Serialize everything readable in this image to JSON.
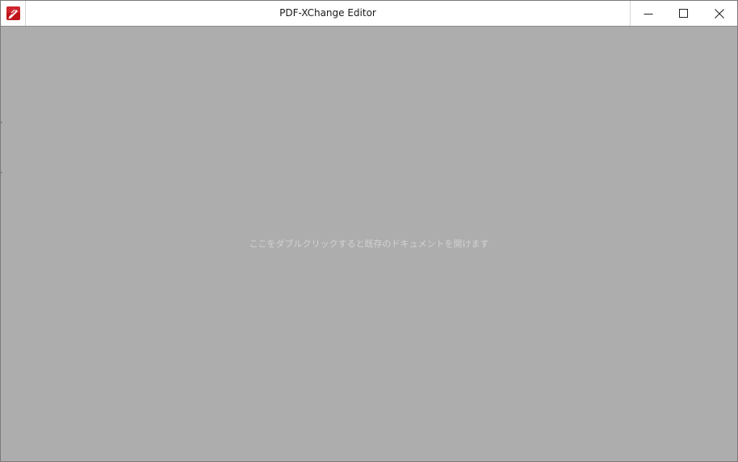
{
  "window": {
    "title": "PDF-XChange Editor",
    "app_icon": "pdf-xchange-app-icon",
    "accent_color": "#c0141c"
  },
  "window_controls": {
    "minimize_icon": "minimize-icon",
    "maximize_icon": "maximize-icon",
    "close_icon": "close-icon"
  },
  "workspace": {
    "hint": "ここをダブルクリックすると既存のドキュメントを開けます",
    "background_color": "#adadad"
  }
}
